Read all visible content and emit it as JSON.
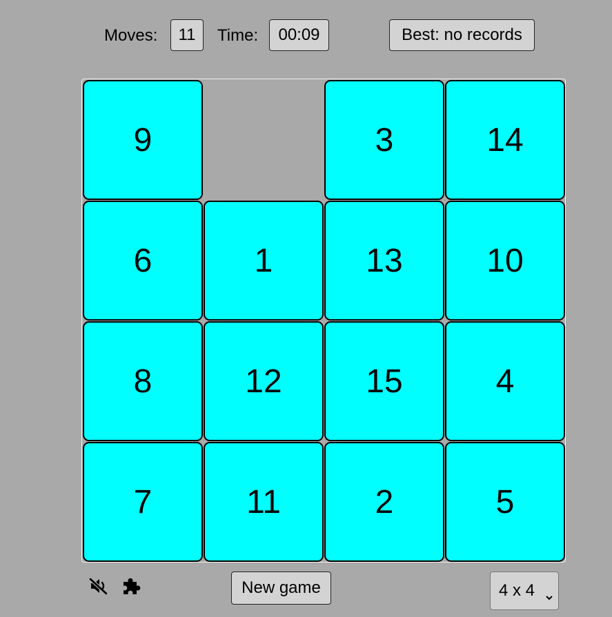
{
  "stats": {
    "moves_label": "Moves:",
    "moves_value": "11",
    "time_label": "Time:",
    "time_value": "00:09"
  },
  "best_button_label": "Best: no records",
  "board": {
    "rows": 4,
    "cols": 4,
    "tiles": [
      9,
      null,
      3,
      14,
      6,
      1,
      13,
      10,
      8,
      12,
      15,
      4,
      7,
      11,
      2,
      5
    ],
    "tile_color": "#00ffff",
    "background_color": "#a9a9a9"
  },
  "footer": {
    "sound_icon": "speaker-muted-icon",
    "puzzle_icon": "puzzle-piece-icon",
    "new_game_label": "New game",
    "size_select_value": "4 x 4"
  }
}
